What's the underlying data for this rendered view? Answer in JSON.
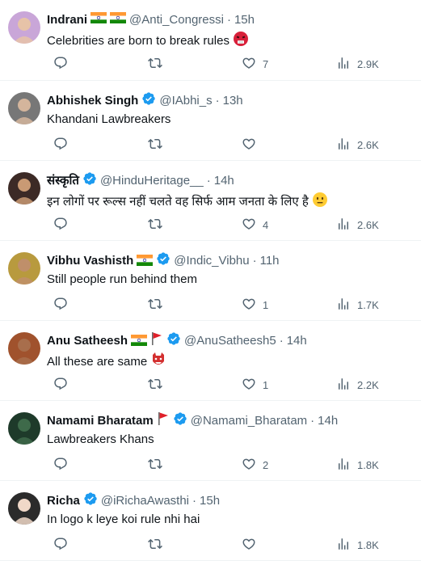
{
  "tweets": [
    {
      "name": "Indrani",
      "handle": "@Anti_Congressi",
      "time": "15h",
      "text": "Celebrities are born to break rules",
      "replies": "",
      "retweets": "",
      "likes": "7",
      "views": "2.9K",
      "badges": [
        "india-flag-icon",
        "india-flag-icon"
      ],
      "emoji": "angry-face-emoji",
      "avatar_color": "#c9a6d8"
    },
    {
      "name": "Abhishek Singh",
      "handle": "@IAbhi_s",
      "time": "13h",
      "text": "Khandani Lawbreakers",
      "replies": "",
      "retweets": "",
      "likes": "",
      "views": "2.6K",
      "badges": [
        "verified-icon"
      ],
      "emoji": "",
      "avatar_color": "#777777"
    },
    {
      "name": "संस्कृति",
      "handle": "@HinduHeritage__",
      "time": "14h",
      "text": "इन लोगों पर रूल्स नहीं चलते वह सिर्फ आम जनता के लिए है",
      "replies": "",
      "retweets": "",
      "likes": "4",
      "views": "2.6K",
      "badges": [
        "verified-icon"
      ],
      "emoji": "neutral-face-emoji",
      "avatar_color": "#3c2a26"
    },
    {
      "name": "Vibhu Vashisth",
      "handle": "@Indic_Vibhu",
      "time": "11h",
      "text": "Still people run behind them",
      "replies": "",
      "retweets": "",
      "likes": "1",
      "views": "1.7K",
      "badges": [
        "india-flag-icon",
        "verified-icon"
      ],
      "emoji": "",
      "avatar_color": "#b89a3e"
    },
    {
      "name": "Anu Satheesh",
      "handle": "@AnuSatheesh5",
      "time": "14h",
      "text": "All these are same",
      "replies": "",
      "retweets": "",
      "likes": "1",
      "views": "2.2K",
      "badges": [
        "india-flag-icon",
        "red-flag-icon",
        "verified-icon"
      ],
      "emoji": "ogre-mask-emoji",
      "avatar_color": "#a0522d"
    },
    {
      "name": "Namami Bharatam",
      "handle": "@Namami_Bharatam",
      "time": "14h",
      "text": "Lawbreakers Khans",
      "replies": "",
      "retweets": "",
      "likes": "2",
      "views": "1.8K",
      "badges": [
        "red-flag-icon",
        "verified-icon"
      ],
      "emoji": "",
      "avatar_color": "#1e3a2a"
    },
    {
      "name": "Richa",
      "handle": "@iRichaAwasthi",
      "time": "15h",
      "text": "In logo k leye koi rule nhi hai",
      "replies": "",
      "retweets": "",
      "likes": "",
      "views": "1.8K",
      "badges": [
        "verified-icon"
      ],
      "emoji": "",
      "avatar_color": "#2b2b2b"
    }
  ],
  "colors": {
    "text": "#0f1419",
    "secondary": "#536471",
    "verified": "#1d9bf0",
    "divider": "#eff3f4"
  }
}
